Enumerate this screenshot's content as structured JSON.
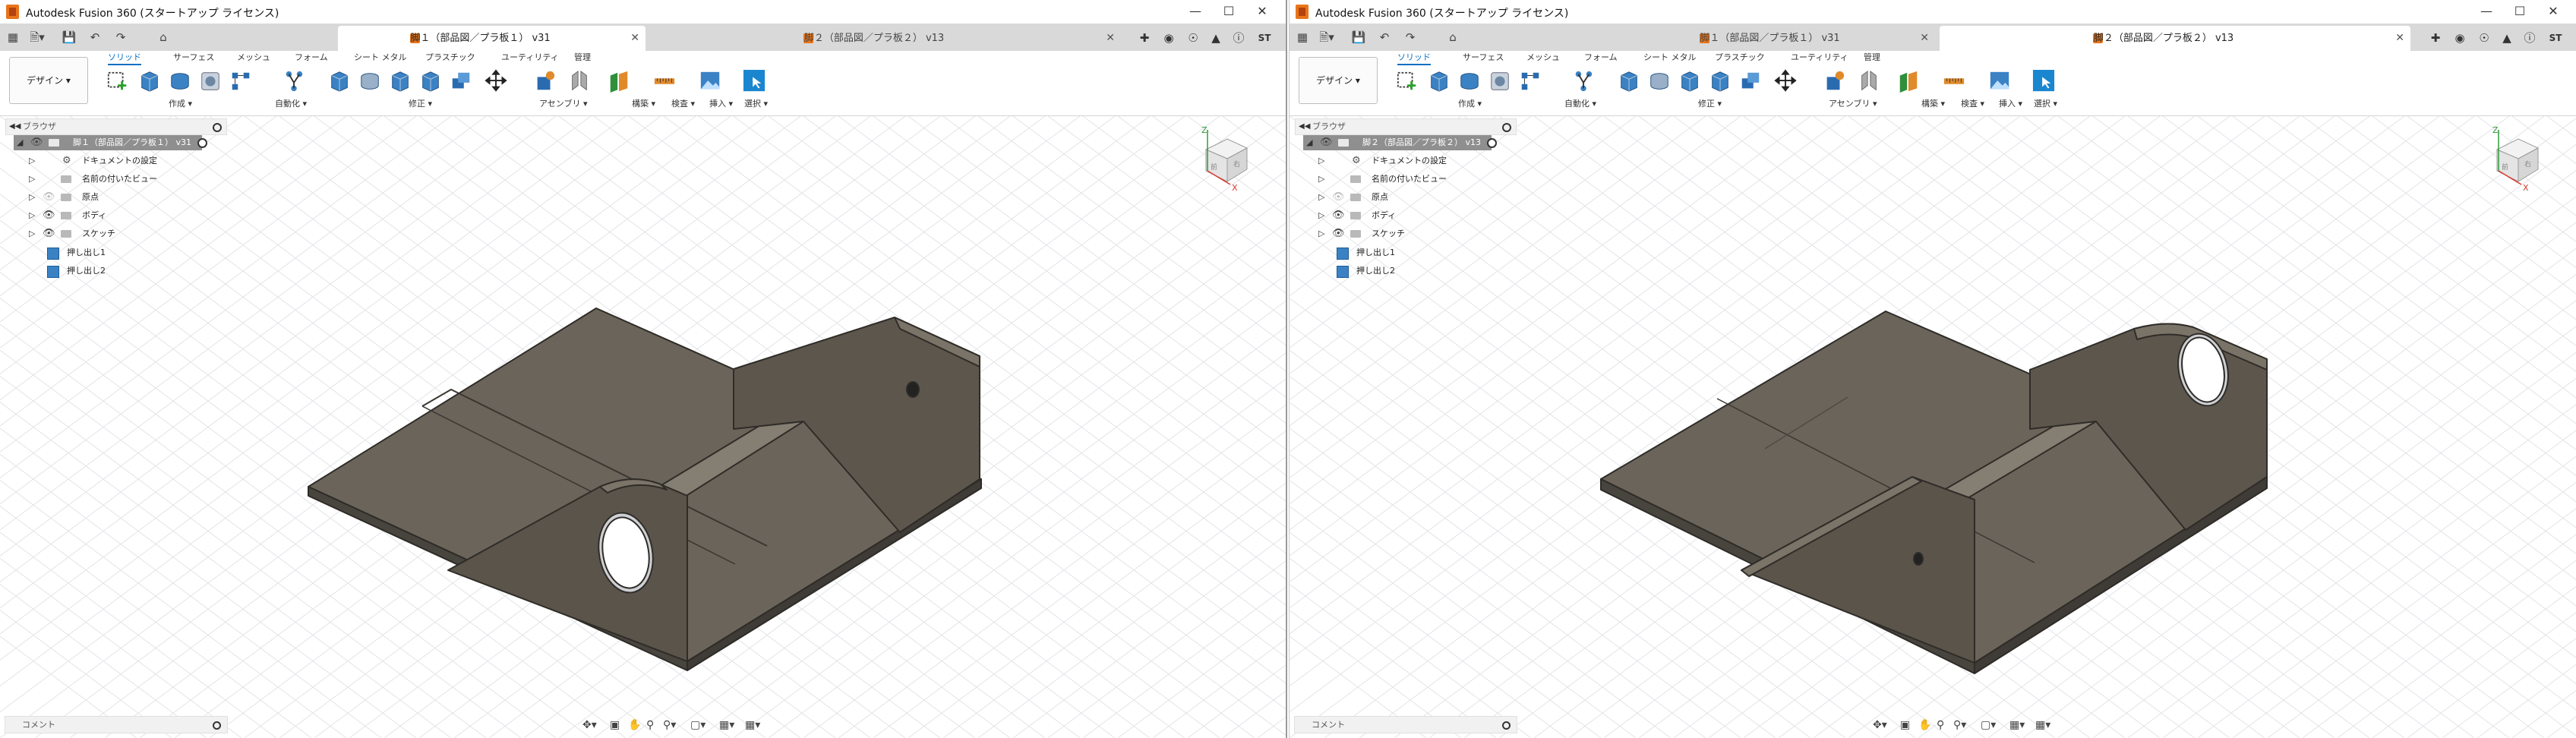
{
  "windows": [
    {
      "title": "Autodesk Fusion 360 (スタートアップ ライセンス)",
      "tabs": [
        {
          "label": "脚１（部品図／プラ板１） v31",
          "active": true
        },
        {
          "label": "脚２（部品図／プラ板２） v13",
          "active": false
        }
      ],
      "user_initials": "ST",
      "workspace": "デザイン",
      "ribbon_tabs": [
        "ソリッド",
        "サーフェス",
        "メッシュ",
        "フォーム",
        "シート メタル",
        "プラスチック",
        "ユーティリティ",
        "管理"
      ],
      "ribbon_groups": [
        "作成",
        "自動化",
        "修正",
        "アセンブリ",
        "構築",
        "検査",
        "挿入",
        "選択"
      ],
      "browser": {
        "title": "ブラウザ",
        "root": "脚１（部品図／プラ板１） v31",
        "items": [
          "ドキュメントの設定",
          "名前の付いたビュー",
          "原点",
          "ボディ",
          "スケッチ"
        ],
        "features": [
          "押し出し1",
          "押し出し2"
        ]
      },
      "comments_label": "コメント"
    },
    {
      "title": "Autodesk Fusion 360 (スタートアップ ライセンス)",
      "tabs": [
        {
          "label": "脚１（部品図／プラ板１） v31",
          "active": false
        },
        {
          "label": "脚２（部品図／プラ板２） v13",
          "active": true
        }
      ],
      "user_initials": "ST",
      "workspace": "デザイン",
      "ribbon_tabs": [
        "ソリッド",
        "サーフェス",
        "メッシュ",
        "フォーム",
        "シート メタル",
        "プラスチック",
        "ユーティリティ",
        "管理"
      ],
      "ribbon_groups": [
        "作成",
        "自動化",
        "修正",
        "アセンブリ",
        "構築",
        "検査",
        "挿入",
        "選択"
      ],
      "browser": {
        "title": "ブラウザ",
        "root": "脚２（部品図／プラ板２） v13",
        "items": [
          "ドキュメントの設定",
          "名前の付いたビュー",
          "原点",
          "ボディ",
          "スケッチ"
        ],
        "features": [
          "押し出し1",
          "押し出し2"
        ]
      },
      "comments_label": "コメント"
    }
  ],
  "colors": {
    "accent": "#0a6fc2",
    "app_orange": "#e8751a",
    "model_face": "#6b645a",
    "model_edge": "#2f2c28",
    "grid": "#e2e4e8"
  },
  "viewcube_axes": [
    "Z",
    "X"
  ]
}
